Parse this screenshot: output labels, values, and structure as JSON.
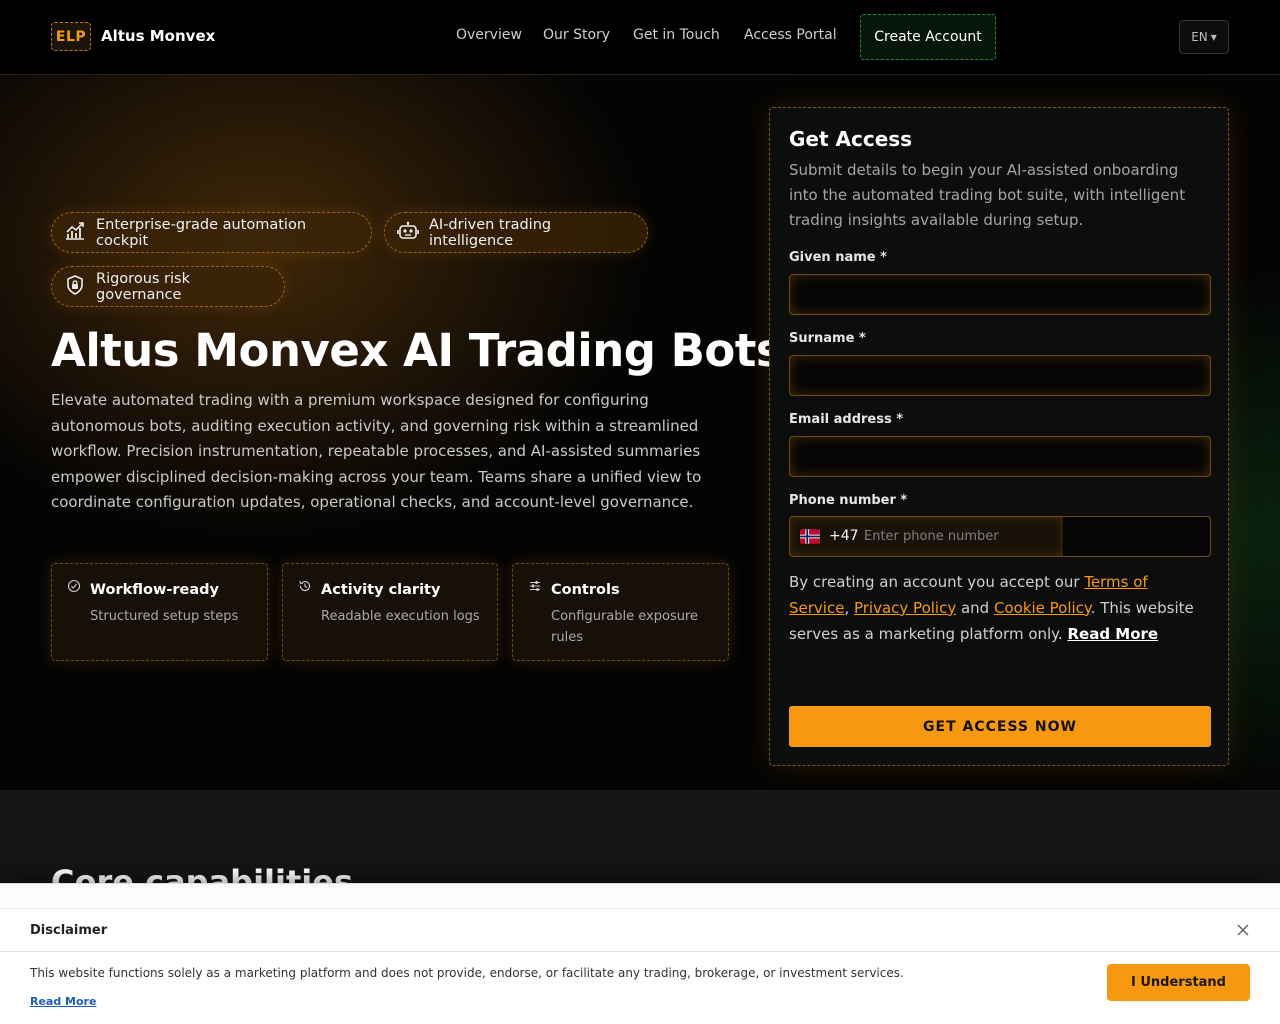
{
  "header": {
    "logo_badge": "ELP",
    "brand_name": "Altus Monvex",
    "nav": {
      "overview": "Overview",
      "story": "Our Story",
      "touch": "Get in Touch",
      "portal": "Access Portal"
    },
    "create_account": "Create Account",
    "language": "EN",
    "language_caret": "▾"
  },
  "hero": {
    "pills": [
      {
        "label": "Enterprise-grade automation cockpit",
        "icon": "chart-line-icon"
      },
      {
        "label": "AI-driven trading intelligence",
        "icon": "robot-icon"
      },
      {
        "label": "Rigorous risk governance",
        "icon": "shield-lock-icon"
      }
    ],
    "title": "Altus Monvex AI Trading Bots",
    "description": "Elevate automated trading with a premium workspace designed for configuring autonomous bots, auditing execution activity, and governing risk within a streamlined workflow. Precision instrumentation, repeatable processes, and AI-assisted summaries empower disciplined decision-making across your team. Teams share a unified view to coordinate configuration updates, operational checks, and account-level governance.",
    "features": [
      {
        "title": "Workflow-ready",
        "subtitle": "Structured setup steps",
        "icon": "check-circle-icon"
      },
      {
        "title": "Activity clarity",
        "subtitle": "Readable execution logs",
        "icon": "history-icon"
      },
      {
        "title": "Controls",
        "subtitle": "Configurable exposure rules",
        "icon": "sliders-icon"
      }
    ]
  },
  "form": {
    "title": "Get Access",
    "description": "Submit details to begin your AI-assisted onboarding into the automated trading bot suite, with intelligent trading insights available during setup.",
    "given_name_label": "Given name *",
    "given_name_value": "",
    "surname_label": "Surname *",
    "surname_value": "",
    "email_label": "Email address *",
    "email_value": "",
    "phone_label": "Phone number *",
    "phone_flag": "norway-flag",
    "phone_code": "+47",
    "phone_placeholder": "Enter phone number",
    "terms": {
      "prefix": "By creating an account you accept our ",
      "terms_link": "Terms of Service",
      "sep1": ", ",
      "privacy_link": "Privacy Policy",
      "and": " and ",
      "cookie_link": "Cookie Policy",
      "suffix": ". This website serves as a marketing platform only. ",
      "read_more": "Read More"
    },
    "submit": "GET ACCESS NOW"
  },
  "section2": {
    "title": "Core capabilities"
  },
  "disclaimer": {
    "title": "Disclaimer",
    "text": "This website functions solely as a marketing platform and does not provide, endorse, or facilitate any trading, brokerage, or investment services.",
    "read_more": "Read More",
    "button": "I Understand"
  },
  "colors": {
    "accent": "#f7980f",
    "create_account_border": "#1f8a3a",
    "link": "#1a5fb4"
  }
}
